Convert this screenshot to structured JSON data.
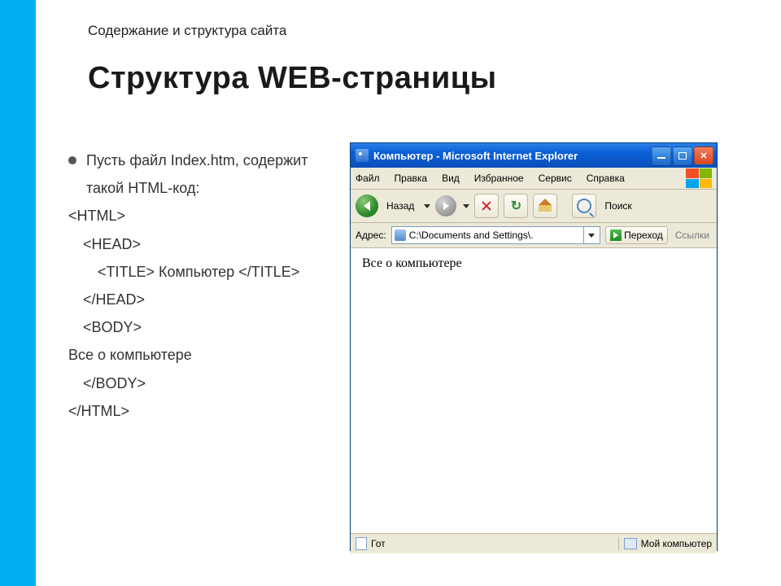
{
  "slide": {
    "subtitle": "Содержание и структура сайта",
    "title": "Структура WEB-страницы"
  },
  "left": {
    "bullet": "Пусть  файл Index.htm, содержит такой HTML-код:",
    "lines": [
      "<HTML>",
      "<HEAD>",
      "<TITLE> Компьютер </TITLE>",
      "</HEAD>",
      "<BODY>",
      "Все о компьютере",
      "</BODY>",
      "</HTML>"
    ]
  },
  "ie": {
    "title": "Компьютер - Microsoft Internet Explorer",
    "menu": [
      "Файл",
      "Правка",
      "Вид",
      "Избранное",
      "Сервис",
      "Справка"
    ],
    "back_label": "Назад",
    "search_label": "Поиск",
    "address_label": "Адрес:",
    "address_value": "C:\\Documents and Settings\\.",
    "go_label": "Переход",
    "links_label": "Ссылки",
    "page_text": "Все о компьютере",
    "status_left": "Гот",
    "status_right": "Мой компьютер"
  }
}
